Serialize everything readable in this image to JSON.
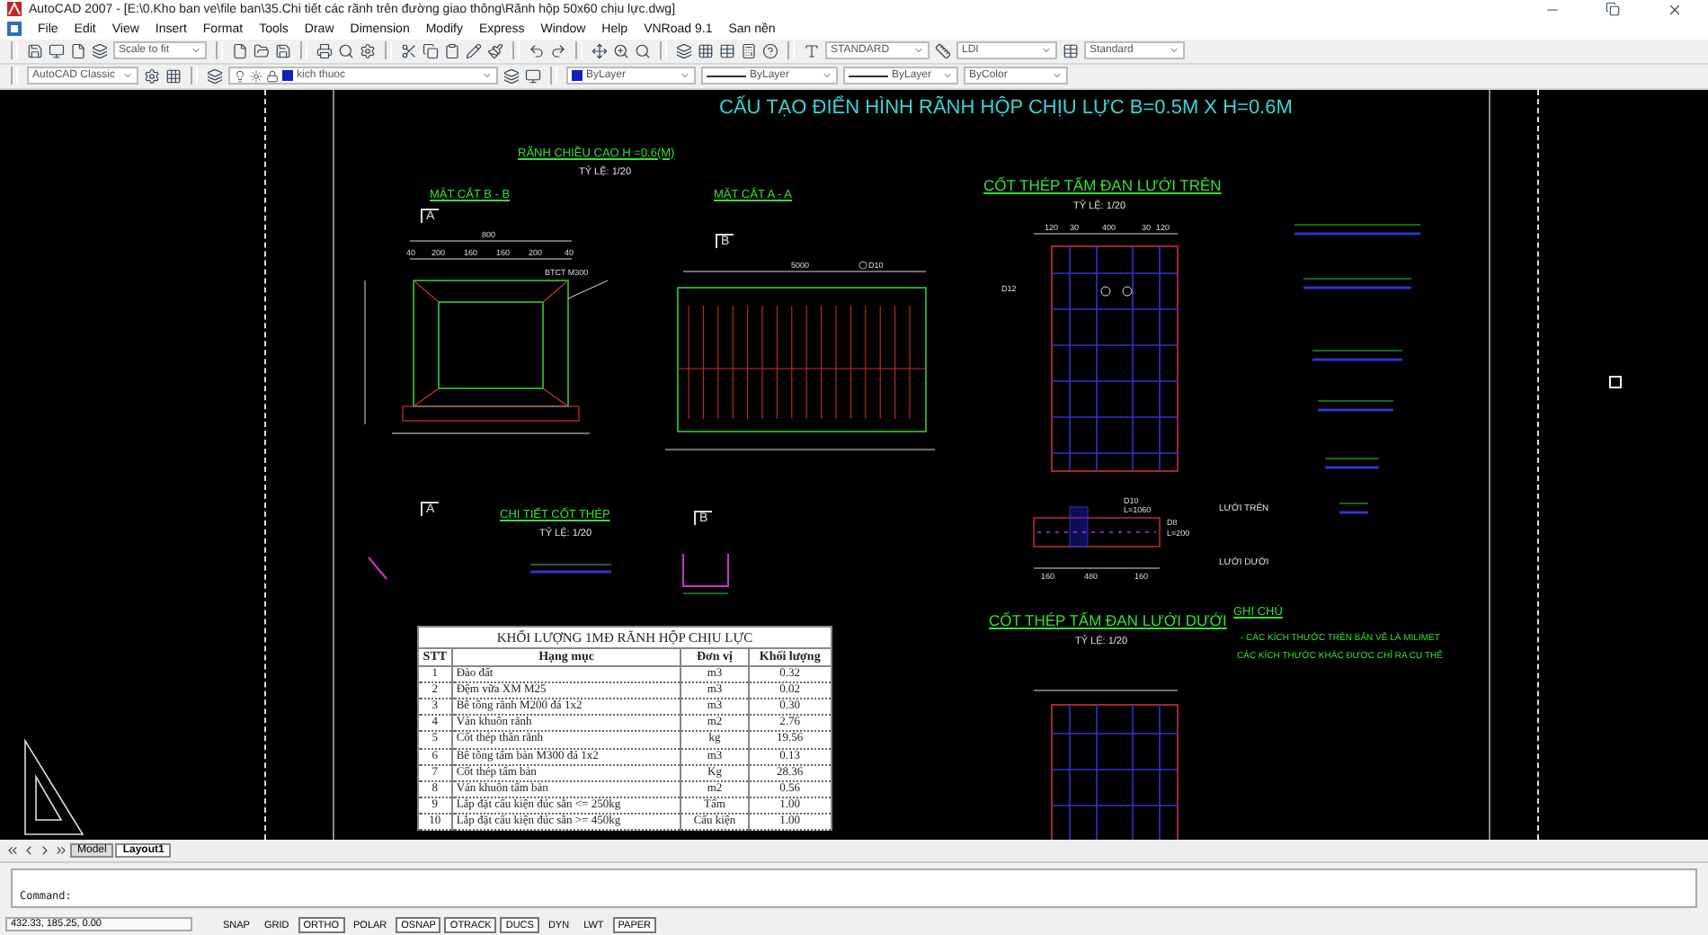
{
  "window": {
    "title": "AutoCAD 2007 - [E:\\0.Kho ban ve\\file ban\\35.Chi tiết các rãnh trên đường giao thông\\Rãnh hộp 50x60 chịu lực.dwg]"
  },
  "menu": [
    "File",
    "Edit",
    "View",
    "Insert",
    "Format",
    "Tools",
    "Draw",
    "Dimension",
    "Modify",
    "Express",
    "Window",
    "Help",
    "VNRoad 9.1",
    "San nền"
  ],
  "toolbars": {
    "scale": "Scale to fit",
    "text_style": "STANDARD",
    "dim_style": "LDI",
    "table_style": "Standard",
    "workspace": "AutoCAD Classic",
    "layer": "kich thuoc",
    "object_color": "ByLayer",
    "linetype": "ByLayer",
    "lineweight": "ByLayer",
    "plot_style": "ByColor"
  },
  "drawing": {
    "annotations": [
      {
        "text": "CẤU TẠO ĐIỂN HÌNH RÃNH HỘP CHỊU LỰC B=0.5M X H=0.6M",
        "kind": "title"
      },
      {
        "text": "RÃNH CHIỀU CAO H =0.6(M)",
        "kind": "subheading"
      },
      {
        "text": "TỶ LỆ: 1/20",
        "kind": "scale"
      },
      {
        "text": "MẶT CẮT B - B",
        "kind": "subheading"
      },
      {
        "text": "MẶT CẮT A - A",
        "kind": "subheading"
      },
      {
        "text": "A",
        "kind": "marker"
      },
      {
        "text": "B",
        "kind": "marker"
      },
      {
        "text": "CỐT THÉP TẤM ĐAN LƯỚI TRÊN",
        "kind": "heading"
      },
      {
        "text": "TỶ LỆ: 1/20",
        "kind": "scale"
      },
      {
        "text": "A",
        "kind": "marker"
      },
      {
        "text": "B",
        "kind": "marker"
      },
      {
        "text": "CHI TIẾT CỐT THÉP",
        "kind": "subheading"
      },
      {
        "text": "TỶ LỆ: 1/20",
        "kind": "scale"
      },
      {
        "text": "LƯỚI TRÊN",
        "kind": "label"
      },
      {
        "text": "LƯỚI DƯỚI",
        "kind": "label"
      },
      {
        "text": "CỐT THÉP TẤM ĐAN LƯỚI DƯỚI",
        "kind": "heading"
      },
      {
        "text": "TỶ LỆ: 1/20",
        "kind": "scale"
      },
      {
        "text": "GHI CHÚ",
        "kind": "subheading"
      },
      {
        "text": "- CÁC KÍCH THƯỚC TRÊN BẢN VẼ LÀ MILIMET",
        "kind": "note"
      },
      {
        "text": "CÁC KÍCH THƯỚC KHÁC ĐƯỢC CHỈ RA CỤ THỂ",
        "kind": "note"
      }
    ],
    "section_labels": [
      "800",
      "40",
      "200",
      "160",
      "160",
      "200",
      "40",
      "BTCT M300"
    ],
    "elevation_labels": [
      "5000",
      "D10"
    ],
    "top_mesh_labels": [
      "120",
      "30",
      "400",
      "30",
      "120",
      "D12"
    ],
    "detail_labels": [
      "D10",
      "L=1060",
      "D8",
      "L=200",
      "160",
      "480",
      "160"
    ],
    "table": {
      "title": "KHỐI LƯỢNG 1MĐ RÃNH HỘP CHỊU LỰC",
      "columns": [
        "STT",
        "Hạng mục",
        "Đơn vị",
        "Khối lượng"
      ],
      "rows": [
        [
          "1",
          "Đào đất",
          "m3",
          "0.32"
        ],
        [
          "2",
          "Đệm vữa XM M25",
          "m3",
          "0.02"
        ],
        [
          "3",
          "Bê tông rãnh M200 đá 1x2",
          "m3",
          "0.30"
        ],
        [
          "4",
          "Ván khuôn rãnh",
          "m2",
          "2.76"
        ],
        [
          "5",
          "Cốt thép thân rãnh",
          "kg",
          "19.56"
        ],
        [
          "6",
          "Bê tông tấm bản M300 đá 1x2",
          "m3",
          "0.13"
        ],
        [
          "7",
          "Cốt thép tấm bản",
          "Kg",
          "28.36"
        ],
        [
          "8",
          "Ván khuôn tấm bản",
          "m2",
          "0.56"
        ],
        [
          "9",
          "Lắp đặt cấu kiện đúc sẵn <= 250kg",
          "Tấm",
          "1.00"
        ],
        [
          "10",
          "Lắp đặt cấu kiện đúc sẵn >= 450kg",
          "Cấu kiện",
          "1.00"
        ]
      ]
    }
  },
  "layout_tabs": [
    {
      "label": "Model",
      "selected": false
    },
    {
      "label": "Layout1",
      "selected": true
    }
  ],
  "command": {
    "prompt": "Command:"
  },
  "status_bar": {
    "coordinates": "432.33, 185.25, 0.00",
    "toggles": [
      {
        "label": "SNAP",
        "on": false
      },
      {
        "label": "GRID",
        "on": false
      },
      {
        "label": "ORTHO",
        "on": true
      },
      {
        "label": "POLAR",
        "on": false
      },
      {
        "label": "OSNAP",
        "on": true
      },
      {
        "label": "OTRACK",
        "on": true
      },
      {
        "label": "DUCS",
        "on": true
      },
      {
        "label": "DYN",
        "on": false
      },
      {
        "label": "LWT",
        "on": false
      },
      {
        "label": "PAPER",
        "on": true
      }
    ]
  }
}
